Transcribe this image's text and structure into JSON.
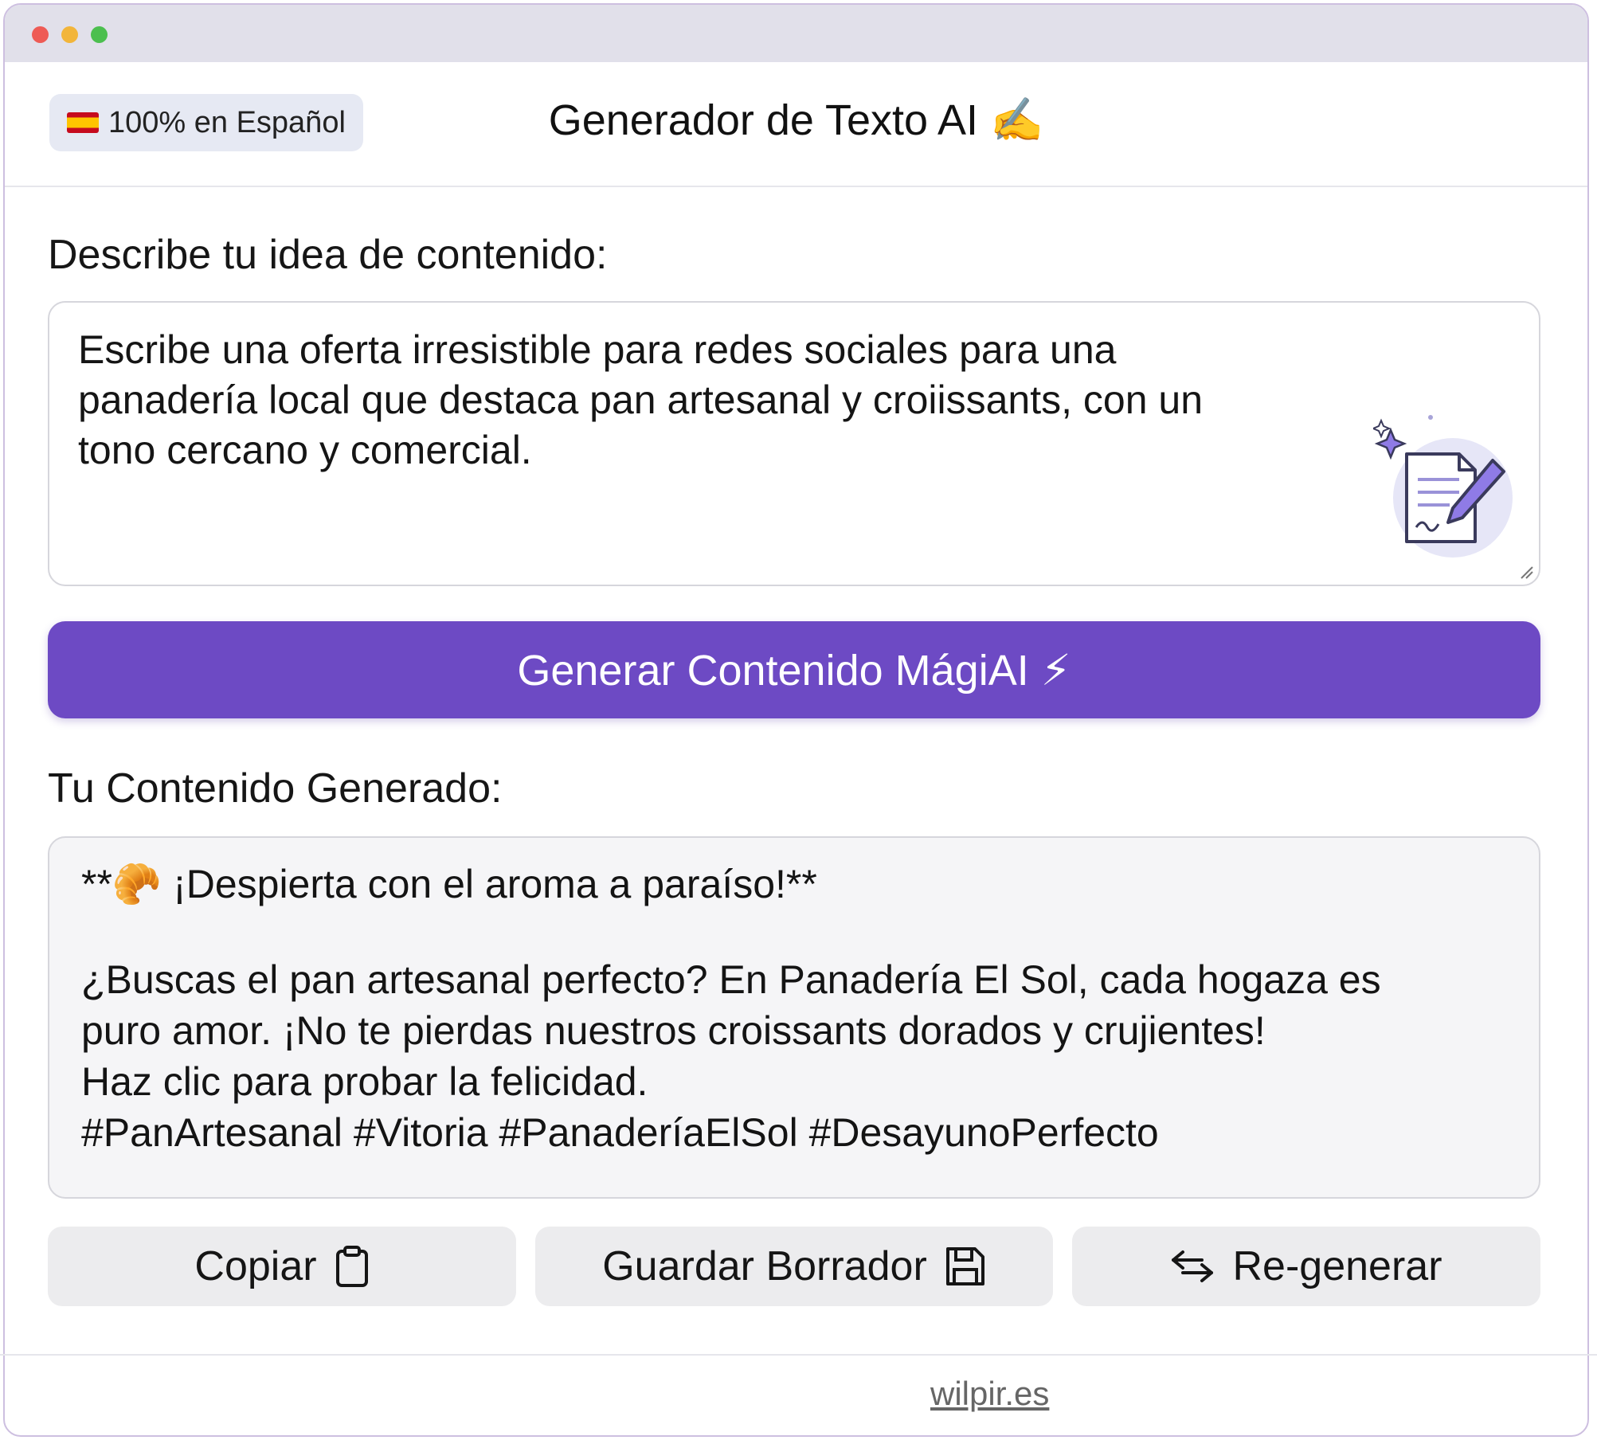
{
  "header": {
    "language_badge": "100% en Español",
    "title": "Generador de Texto AI ✍️"
  },
  "prompt": {
    "label": "Describe tu idea de contenido:",
    "lines": [
      "Escribe una oferta irresistible para redes sociales para una",
      "panadería local que destaca pan artesanal y croiissants, con un",
      "tono cercano y comercial."
    ]
  },
  "generate_button": {
    "label": "Generar Contenido MágiAI ⚡"
  },
  "output": {
    "label": "Tu Contenido Generado:",
    "headline": "**🥐 ¡Despierta con el aroma a paraíso!**",
    "body_lines": [
      "¿Buscas el pan artesanal perfecto? En Panadería El Sol, cada hogaza es",
      "puro amor. ¡No te pierdas nuestros croissants dorados y crujientes!",
      "Haz clic para probar la felicidad.",
      "#PanArtesanal #Vitoria #PanaderíaElSol #DesayunoPerfecto"
    ]
  },
  "actions": {
    "copy_label": "Copiar",
    "save_label": "Guardar Borrador",
    "regen_label": "Re-generar"
  },
  "footer": {
    "link": "wilpir.es"
  },
  "icons": {
    "copy": "clipboard-icon",
    "save": "floppy-disk-icon",
    "regen": "swap-arrows-icon",
    "illustration": "document-pen-icon",
    "flag": "spain-flag-icon"
  },
  "colors": {
    "accent": "#6d4ac4",
    "titlebar": "#e1e0ea",
    "badge": "#e6e9f3",
    "button_secondary": "#ececee"
  }
}
